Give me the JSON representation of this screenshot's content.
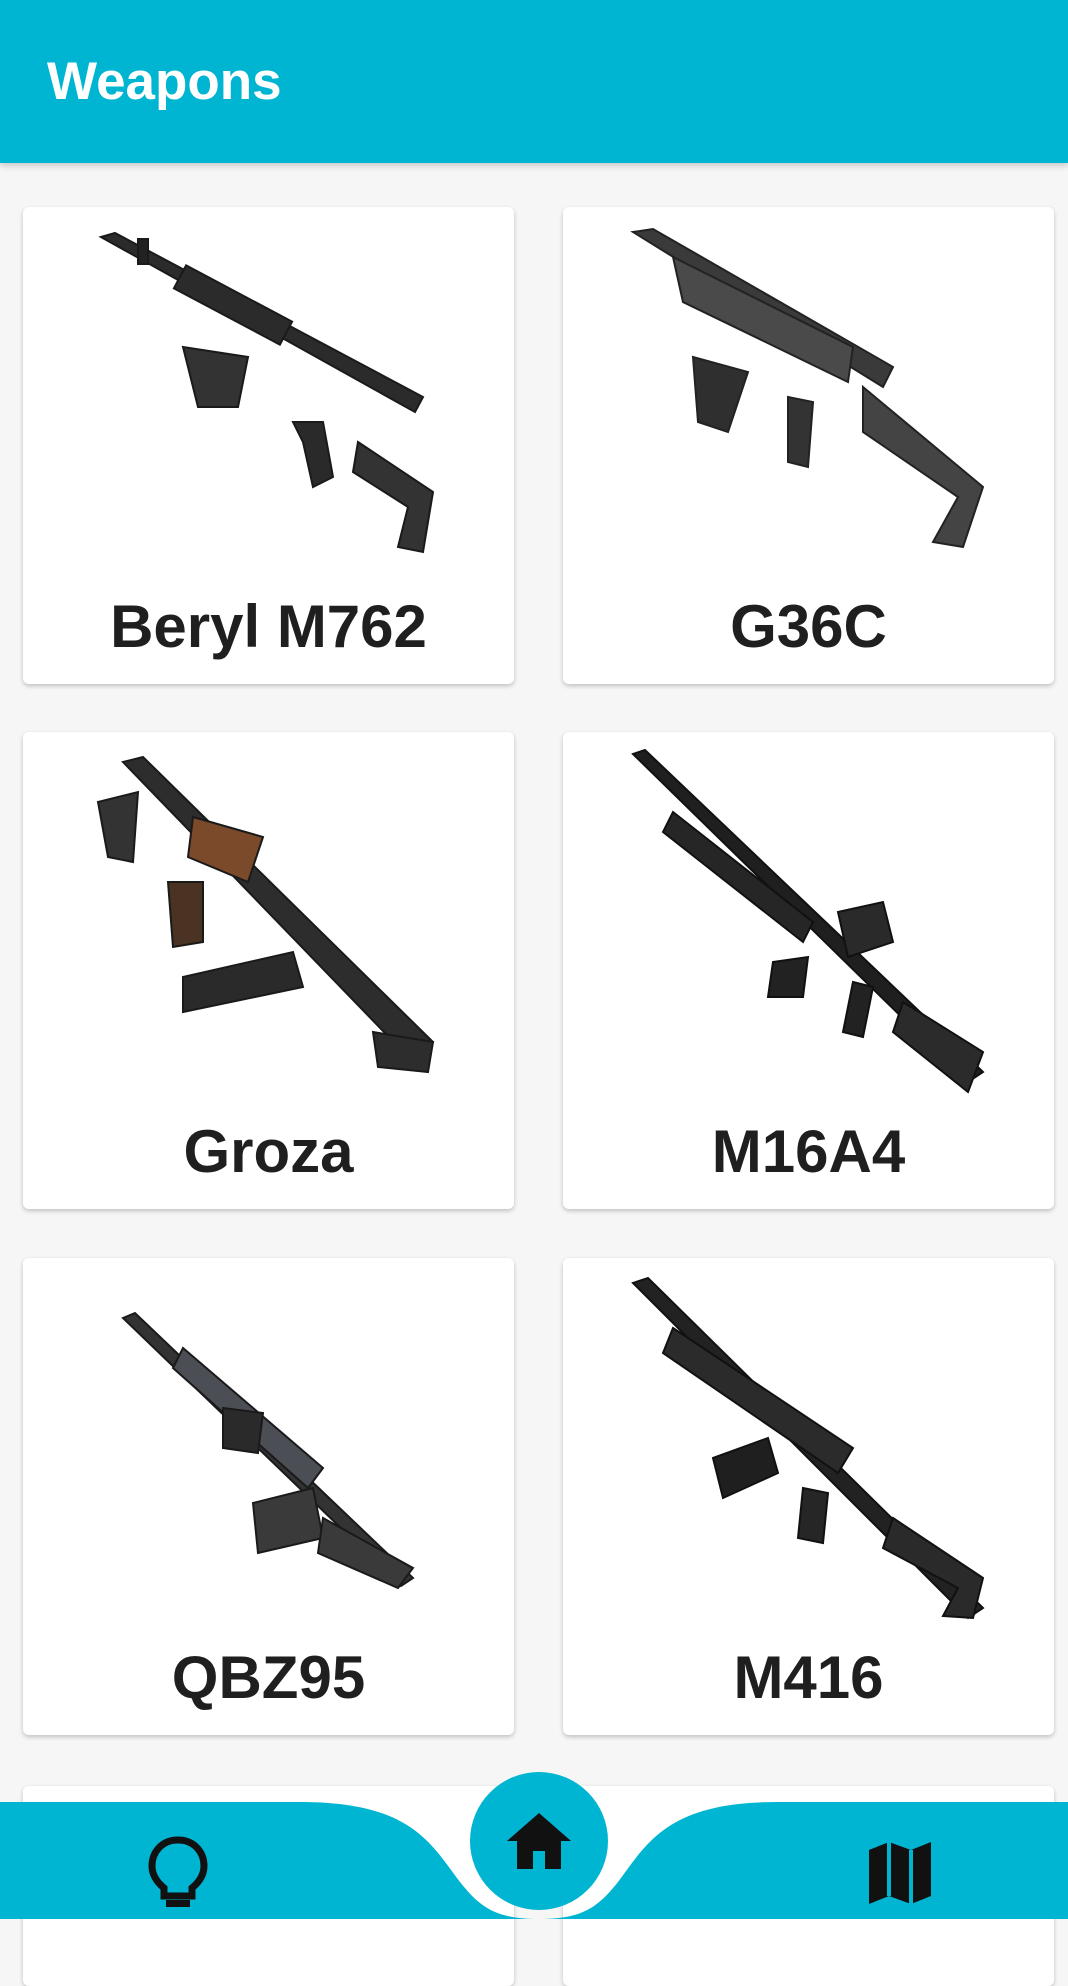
{
  "app_bar": {
    "title": "Weapons"
  },
  "weapons": [
    {
      "name": "Beryl M762",
      "icon": "beryl-m762-rifle-image"
    },
    {
      "name": "G36C",
      "icon": "g36c-rifle-image"
    },
    {
      "name": "Groza",
      "icon": "groza-rifle-image"
    },
    {
      "name": "M16A4",
      "icon": "m16a4-rifle-image"
    },
    {
      "name": "QBZ95",
      "icon": "qbz95-rifle-image"
    },
    {
      "name": "M416",
      "icon": "m416-rifle-image"
    }
  ],
  "bottom_nav": {
    "left_icon": "lightbulb-icon",
    "center_icon": "home-icon",
    "right_icon": "map-icon"
  },
  "colors": {
    "primary": "#00b5d1",
    "background": "#f6f6f6",
    "card": "#ffffff",
    "text": "#1f1f1f"
  }
}
